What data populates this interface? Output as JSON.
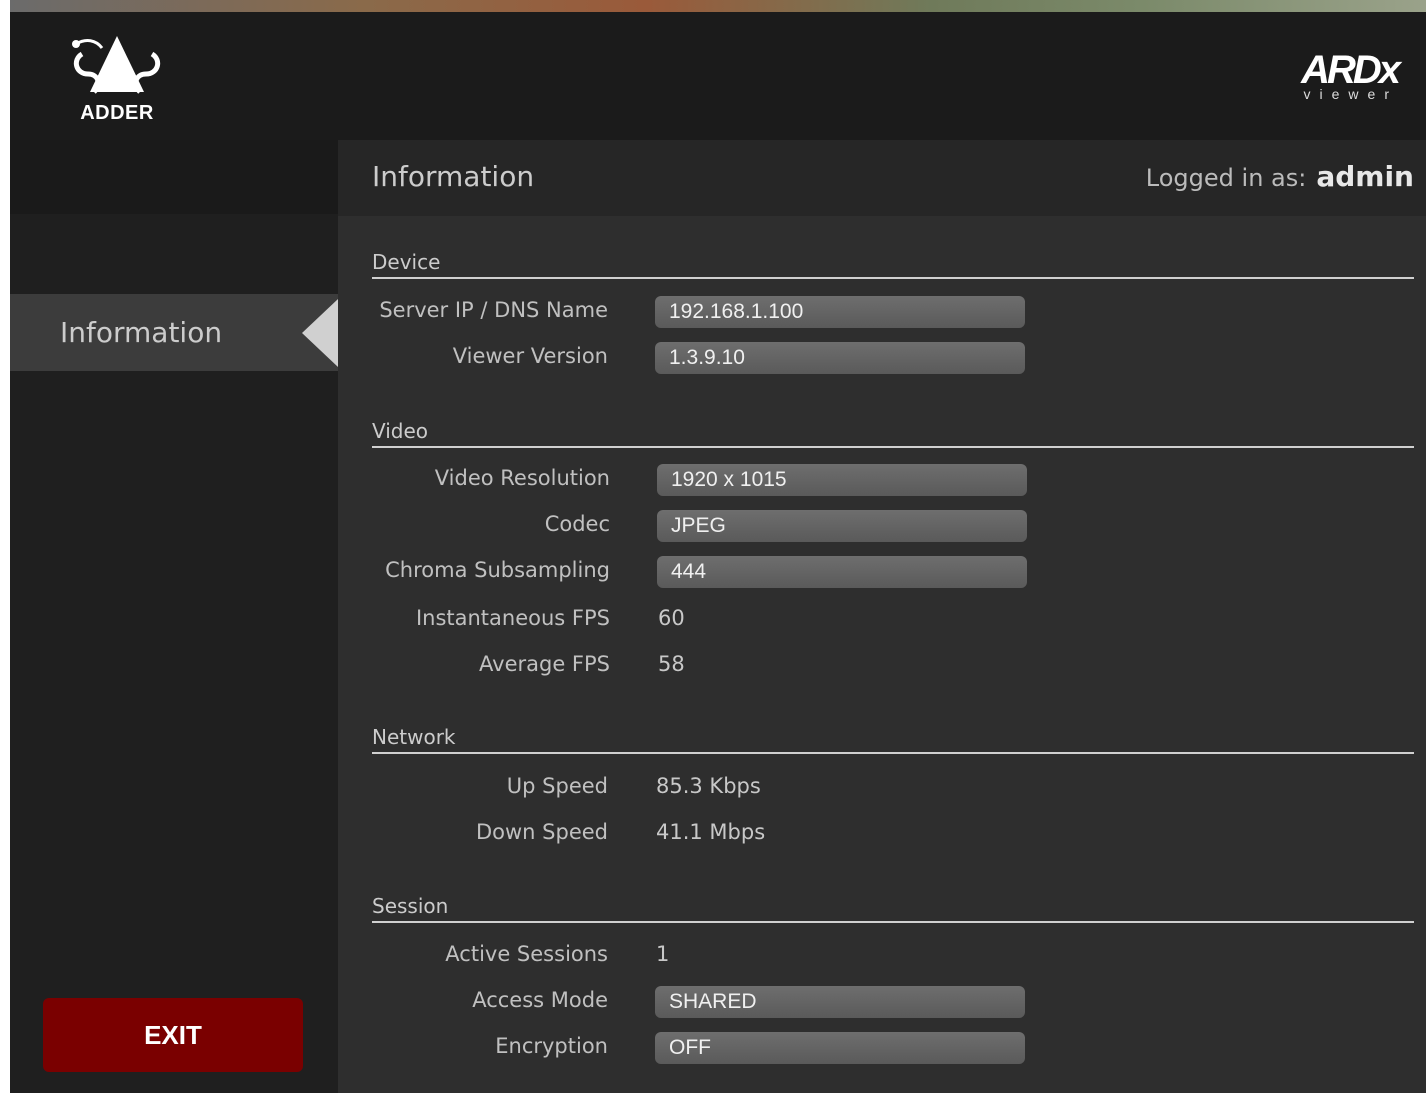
{
  "brand": {
    "adder": "ADDER",
    "product": "ARDx",
    "product_sub": "viewer"
  },
  "sidebar": {
    "items": [
      {
        "label": "Information"
      }
    ],
    "exit_label": "EXIT"
  },
  "header": {
    "title": "Information",
    "logged_in_label": "Logged in as:",
    "user": "admin"
  },
  "sections": {
    "device": {
      "title": "Device",
      "server_ip_label": "Server IP / DNS Name",
      "server_ip": "192.168.1.100",
      "viewer_version_label": "Viewer Version",
      "viewer_version": "1.3.9.10"
    },
    "video": {
      "title": "Video",
      "resolution_label": "Video Resolution",
      "resolution": "1920 x 1015",
      "codec_label": "Codec",
      "codec": "JPEG",
      "chroma_label": "Chroma Subsampling",
      "chroma": "444",
      "inst_fps_label": "Instantaneous FPS",
      "inst_fps": "60",
      "avg_fps_label": "Average FPS",
      "avg_fps": "58"
    },
    "network": {
      "title": "Network",
      "up_label": "Up Speed",
      "up": "85.3 Kbps",
      "down_label": "Down Speed",
      "down": "41.1 Mbps"
    },
    "session": {
      "title": "Session",
      "active_label": "Active Sessions",
      "active": "1",
      "access_label": "Access Mode",
      "access": "SHARED",
      "encryption_label": "Encryption",
      "encryption": "OFF"
    }
  },
  "colors": {
    "exit": "#7a0000",
    "background": "#2e2e2e",
    "sidebar": "#1f1f1f"
  }
}
